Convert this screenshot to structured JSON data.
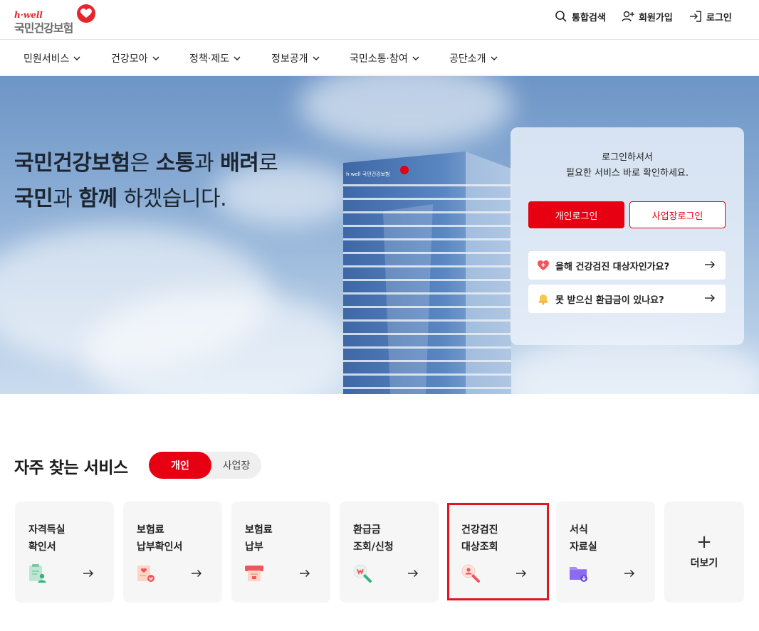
{
  "header": {
    "logo_brand": "h·well",
    "logo_name": "국민건강보험",
    "utils": {
      "search": "통합검색",
      "join": "회원가입",
      "login": "로그인"
    }
  },
  "gnb": {
    "items": [
      "민원서비스",
      "건강모아",
      "정책·제도",
      "정보공개",
      "국민소통·참여",
      "공단소개"
    ]
  },
  "hero": {
    "line1": [
      {
        "text": "국민건강보험",
        "bold": true
      },
      {
        "text": "은 ",
        "bold": false
      },
      {
        "text": "소통",
        "bold": true
      },
      {
        "text": "과 ",
        "bold": false
      },
      {
        "text": "배려",
        "bold": true
      },
      {
        "text": "로",
        "bold": false
      }
    ],
    "line2": [
      {
        "text": "국민",
        "bold": true
      },
      {
        "text": "과 ",
        "bold": false
      },
      {
        "text": "함께",
        "bold": true
      },
      {
        "text": " 하겠습니다.",
        "bold": false
      }
    ],
    "building_sign": "h·well 국민건강보험"
  },
  "login_card": {
    "message_line1": "로그인하셔서",
    "message_line2": "필요한 서비스 바로 확인하세요.",
    "personal_login": "개인로그인",
    "business_login": "사업장로그인",
    "quick_links": [
      {
        "label": "올해 건강검진 대상자인가요?",
        "icon": "heart-shield-icon"
      },
      {
        "label": "못 받으신 환급금이 있나요?",
        "icon": "bell-icon"
      }
    ]
  },
  "services": {
    "title": "자주 찾는 서비스",
    "toggle_personal": "개인",
    "toggle_business": "사업장",
    "cards": [
      {
        "label": "자격득실\n확인서",
        "icon": "qualification-certificate-icon"
      },
      {
        "label": "보험료\n납부확인서",
        "icon": "payment-certificate-icon"
      },
      {
        "label": "보험료\n납부",
        "icon": "payment-icon"
      },
      {
        "label": "환급금\n조회/신청",
        "icon": "refund-search-icon"
      },
      {
        "label": "건강검진\n대상조회",
        "icon": "checkup-search-icon"
      },
      {
        "label": "서식\n자료실",
        "icon": "forms-folder-icon"
      }
    ],
    "more_label": "더보기",
    "more_symbol": "+"
  },
  "colors": {
    "accent": "#e60012",
    "highlight": "#e3161f",
    "card_bg": "#f6f6f6"
  }
}
